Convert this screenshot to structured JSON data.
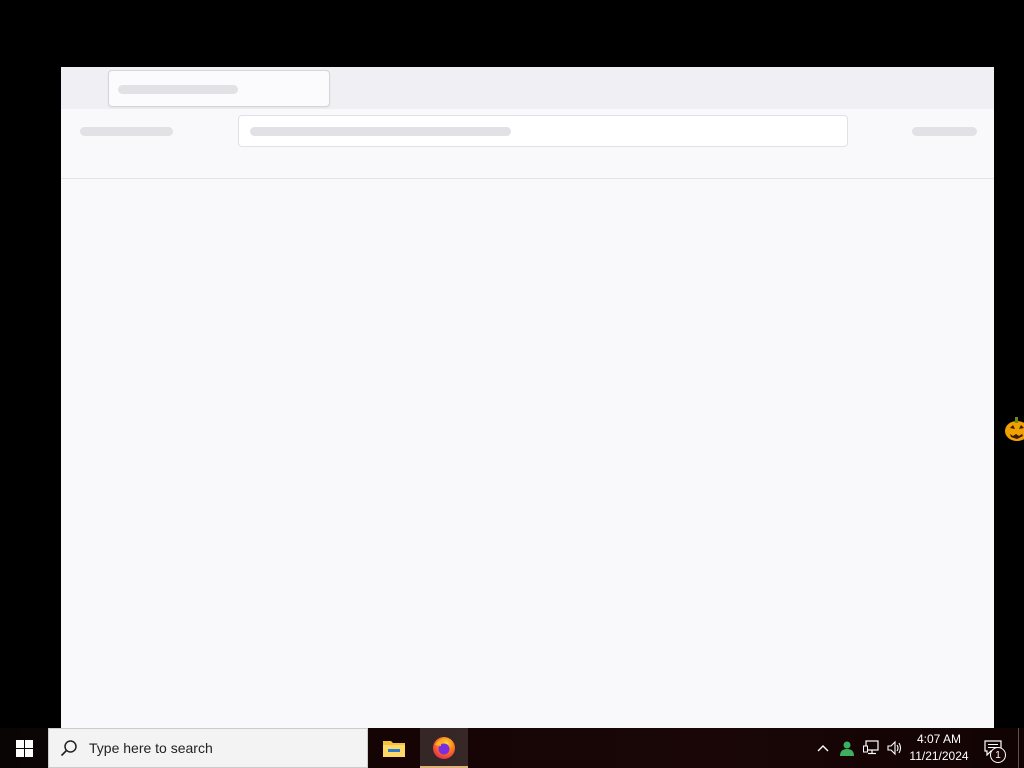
{
  "taskbar": {
    "search_placeholder": "Type here to search",
    "clock_time": "4:07 AM",
    "clock_date": "11/21/2024",
    "notification_count": "1",
    "pinned": [
      "file-explorer-icon",
      "firefox-icon"
    ],
    "tray": [
      "chevron-up-icon",
      "user-account-icon",
      "network-icon",
      "volume-icon"
    ]
  },
  "browser": {
    "state": "loading-skeleton",
    "tab_title": "",
    "url": ""
  },
  "colors": {
    "window_bg": "#f9f9fb",
    "tabbar_bg": "#f0f0f4",
    "skeleton": "#e1e1e6",
    "taskbar_bg": "#160404"
  }
}
